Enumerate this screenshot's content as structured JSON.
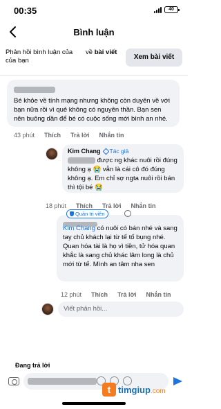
{
  "status_bar": {
    "time": "00:35",
    "battery": "40"
  },
  "header": {
    "title": "Bình luận"
  },
  "context": {
    "left_text": "Phản hồi bình luận của của bạn",
    "mid_prefix": "về ",
    "mid_bold": "bài viết",
    "view_post_label": "Xem bài viết"
  },
  "comments": [
    {
      "text": "Bé khỏe về tính mạng nhưng không còn duyên về với bạn nữa rồi vì quẻ không có nguyên thần. Bạn sen nên buông dần để bé có cuộc sống mới bình an nhé.",
      "time": "43 phút",
      "like": "Thích",
      "reply": "Trả lời",
      "message": "Nhắn tin"
    },
    {
      "author": "Kim Chang",
      "badge": "Tác giả",
      "text": "được ng khác nuôi rồi đúng không ạ 😭 vẫn là cái cô đó đúng không ạ. Em chỉ sợ ngta nuôi rồi bán thì tội bé 😭",
      "time": "18 phút",
      "like": "Thích",
      "reply": "Trả lời",
      "message": "Nhắn tin"
    },
    {
      "badge": "Quản trị viên",
      "mention": "Kim Chang",
      "text": " có nuôi có bán nhé và sang tay chủ khách lại từ tế tố bụng nhé. Quan hóa tài là họ vì tiền, tử hóa quan khắc là sang chủ khác lâm long là chủ mới từ tế. Mình an tâm nha sen",
      "time": "12 phút",
      "like": "Thích",
      "reply": "Trả lời",
      "message": "Nhắn tin"
    }
  ],
  "reply_box": {
    "placeholder": "Viết phản hồi..."
  },
  "composer": {
    "replying_label": "Đang trả lời"
  },
  "watermark": {
    "logo": "t",
    "name": "timgiup",
    "suffix": ".com"
  }
}
